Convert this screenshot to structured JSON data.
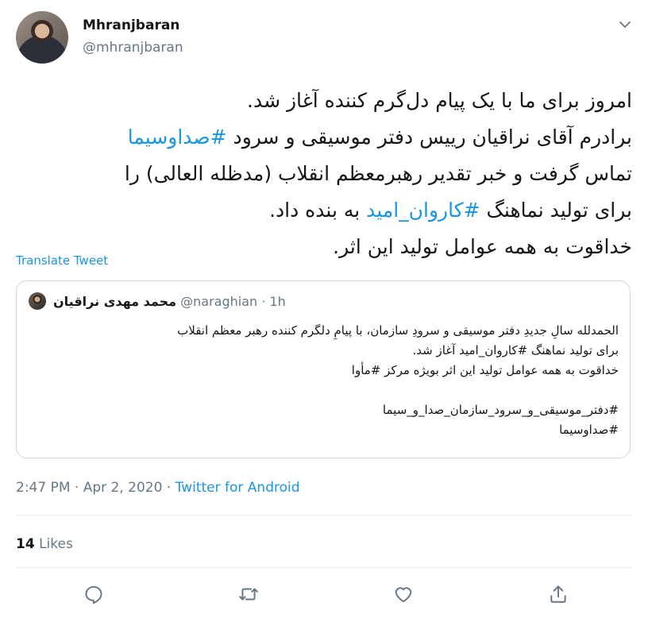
{
  "author": {
    "name": "Mhranjbaran",
    "handle": "@mhranjbaran"
  },
  "tweet": {
    "lines": [
      "امروز برای ما با یک پیام دل‌گرم کننده آغاز شد.",
      "برادرم آقای نراقیان رییس دفتر موسیقی و سرود ",
      "تماس گرفت و خبر تقدیر رهبرمعظم انقلاب (مدظله العالی) را",
      "برای تولید نماهنگ ",
      "خداقوت به همه عوامل تولید این اثر."
    ],
    "hashtag_1": "#صداوسیما",
    "hashtag_2": "#کاروان_امید",
    "line4_tail": " به بنده داد."
  },
  "translate_label": "Translate Tweet",
  "quoted": {
    "name": "محمد مهدی نراقیان",
    "handle": "@naraghian",
    "separator": " · ",
    "time": "1h",
    "lines": [
      "الحمدلله سالِ جدیدِ دفتر موسیقی و سرودِ سازمان، با پیامِ دلگرم کننده رهبر معظم انقلاب",
      "برای تولید نماهنگ #کاروان_امید آغاز شد.",
      "خداقوت به همه عوامل تولید این اثر بویژه مرکز #مأوا",
      "",
      "#دفتر_موسیقی_و_سرود_سازمان_صدا_و_سیما",
      "#صداوسیما"
    ]
  },
  "timestamp": {
    "time_date": "2:47 PM · Apr 2, 2020 · ",
    "source": "Twitter for Android"
  },
  "likes": {
    "count": "14",
    "label": "Likes"
  },
  "colors": {
    "link": "#1b95e0",
    "muted": "#657786",
    "text": "#14171a",
    "border": "#ccd6dd"
  },
  "icons": {
    "reply": "reply-icon",
    "retweet": "retweet-icon",
    "like": "heart-icon",
    "share": "share-icon",
    "more": "chevron-down-icon"
  }
}
